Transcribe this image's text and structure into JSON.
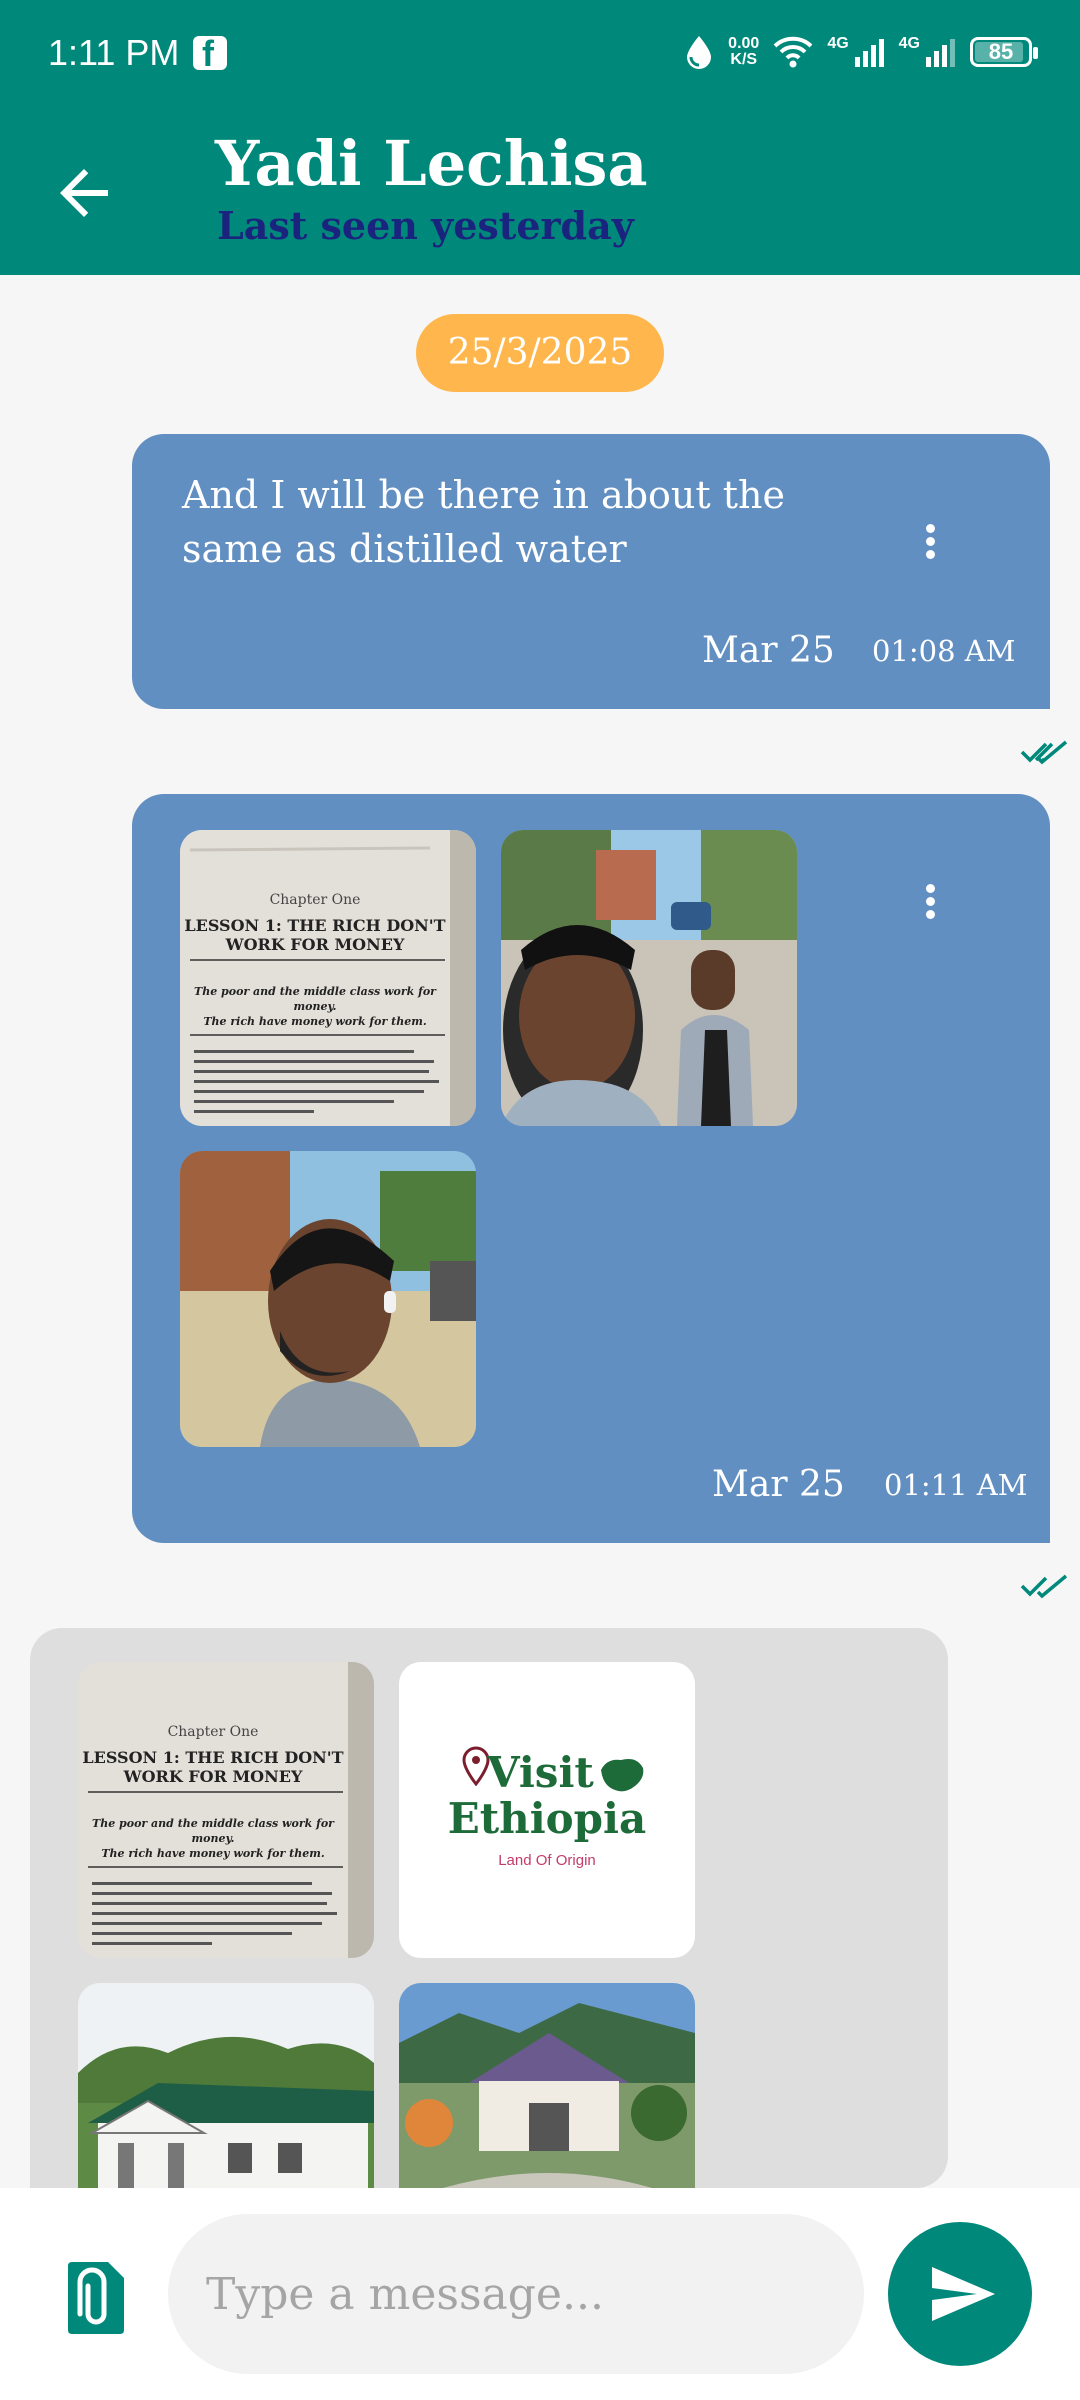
{
  "status_bar": {
    "time": "1:11 PM",
    "net_speed_value": "0.00",
    "net_speed_unit": "K/S",
    "sig1": "4G",
    "sig2": "4G",
    "battery": "85",
    "battery_level": 0.85,
    "icons": [
      "facebook-icon",
      "data-saver-icon",
      "wifi-icon",
      "signal-icon",
      "battery-icon"
    ]
  },
  "header": {
    "contact_name": "Yadi Lechisa",
    "last_seen": "Last seen yesterday",
    "accent_color": "#00897b"
  },
  "date_chip": "25/3/2025",
  "messages": [
    {
      "text": "And I will be there in about the same as distilled water",
      "date": "Mar 25",
      "time": "01:08 AM",
      "status": "read"
    },
    {
      "images": [
        "book-page-photo",
        "selfie-with-friend-photo",
        "profile-photo"
      ],
      "date": "Mar 25",
      "time": "01:11 AM",
      "status": "read"
    },
    {
      "images": [
        "book-page-photo",
        "visit-ethiopia-logo",
        "lodge-building-photo",
        "resort-building-photo"
      ],
      "logo": {
        "line1": "Visit",
        "line2": "Ethiopia",
        "tagline": "Land Of Origin"
      }
    }
  ],
  "book": {
    "chapter": "Chapter One",
    "lesson_line1": "LESSON 1: THE RICH DON'T",
    "lesson_line2": "WORK FOR MONEY",
    "quote1": "The poor and the middle class work for money.",
    "quote2": "The rich have money work for them."
  },
  "composer": {
    "placeholder": "Type a message..."
  },
  "colors": {
    "outgoing_bubble": "#628fc2",
    "incoming_bubble": "#dedede",
    "date_chip": "#ffb74d",
    "last_seen": "#1a237e"
  }
}
